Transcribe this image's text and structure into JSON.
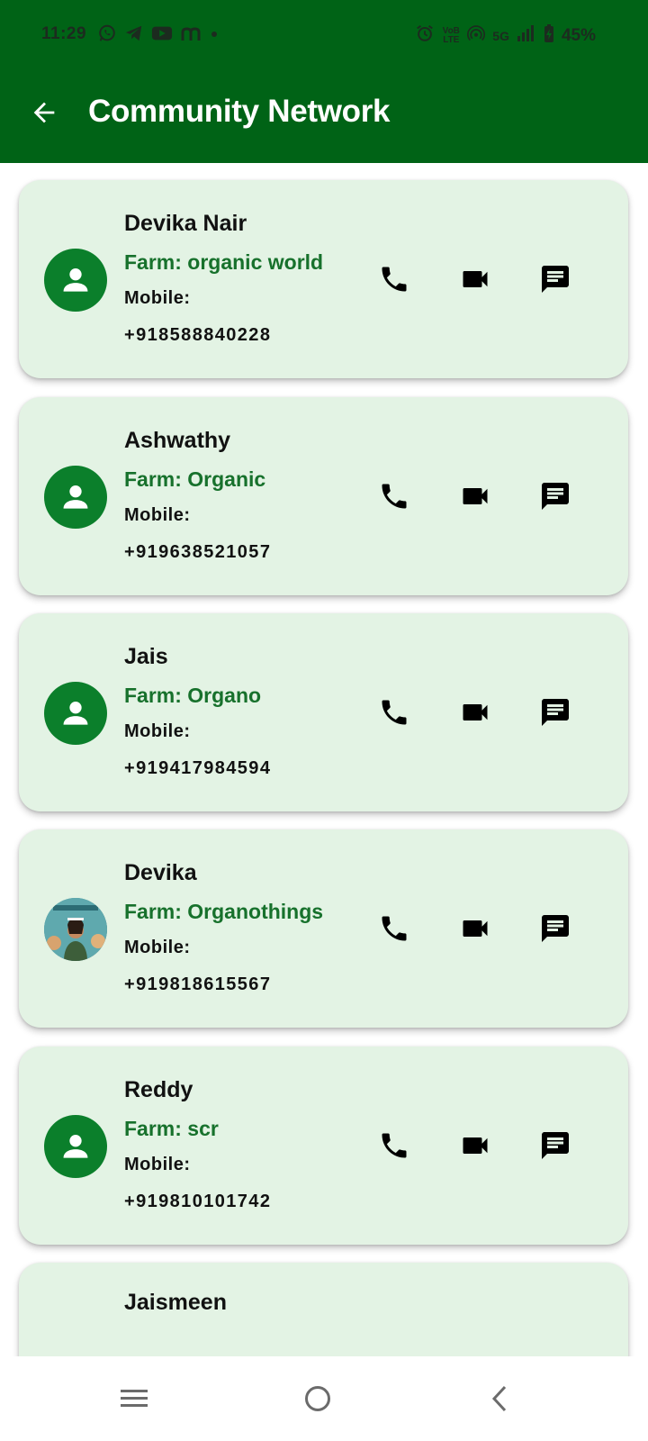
{
  "status_bar": {
    "time": "11:29",
    "network": "5G",
    "battery": "45%",
    "volte_label": "VoB LTE"
  },
  "header": {
    "title": "Community Network",
    "background_color": "#006316"
  },
  "contacts": [
    {
      "name": "Devika Nair",
      "farm": "Farm: organic world",
      "mobile_label": "Mobile:",
      "phone": "+918588840228",
      "avatar": "person-icon"
    },
    {
      "name": "Ashwathy",
      "farm": "Farm: Organic",
      "mobile_label": "Mobile:",
      "phone": "+919638521057",
      "avatar": "person-icon"
    },
    {
      "name": "Jais",
      "farm": "Farm: Organo",
      "mobile_label": "Mobile:",
      "phone": "+919417984594",
      "avatar": "person-icon"
    },
    {
      "name": "Devika",
      "farm": "Farm: Organothings",
      "mobile_label": "Mobile:",
      "phone": "+919818615567",
      "avatar": "profile-photo"
    },
    {
      "name": "Reddy",
      "farm": "Farm: scr",
      "mobile_label": "Mobile:",
      "phone": "+919810101742",
      "avatar": "person-icon"
    },
    {
      "name": "Jaismeen",
      "farm": "",
      "mobile_label": "",
      "phone": "",
      "avatar": "person-icon"
    }
  ],
  "actions": [
    "phone-icon",
    "video-camera-icon",
    "message-icon"
  ],
  "colors": {
    "card_background": "#e3f3e4",
    "farm_text": "#17712c",
    "avatar": "#0b7f2b"
  }
}
